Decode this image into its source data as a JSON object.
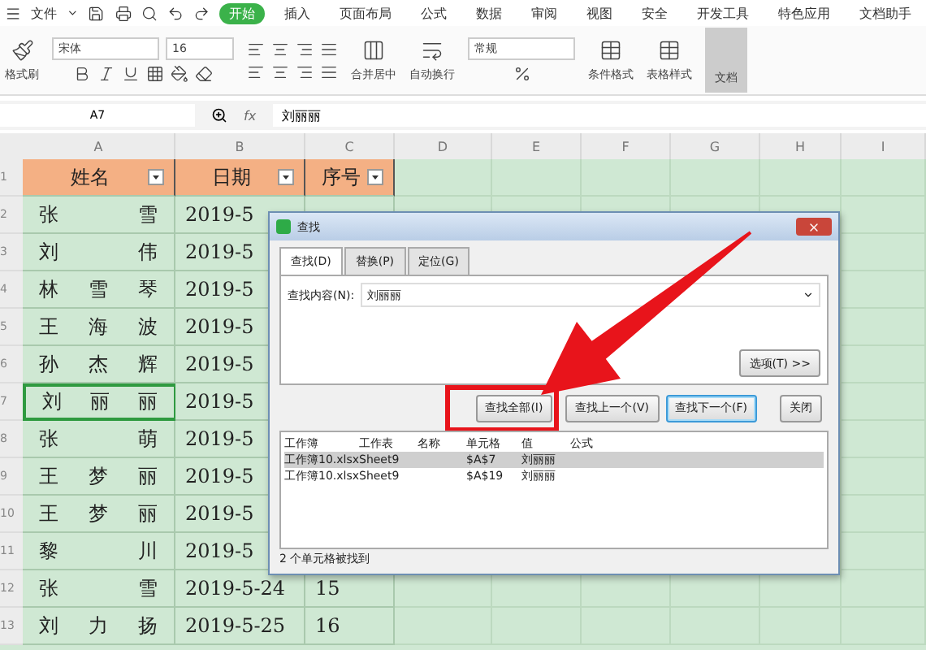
{
  "menu": {
    "label": "文件"
  },
  "ribbon_tabs": [
    {
      "label": "开始",
      "selected": true
    },
    {
      "label": "插入",
      "selected": false
    },
    {
      "label": "页面布局",
      "selected": false
    },
    {
      "label": "公式",
      "selected": false
    },
    {
      "label": "数据",
      "selected": false
    },
    {
      "label": "审阅",
      "selected": false
    },
    {
      "label": "视图",
      "selected": false
    },
    {
      "label": "安全",
      "selected": false
    },
    {
      "label": "开发工具",
      "selected": false
    },
    {
      "label": "特色应用",
      "selected": false
    },
    {
      "label": "文档助手",
      "selected": false
    }
  ],
  "toolbar": {
    "format_painter": "格式刷",
    "font": "宋体",
    "font_size": "16",
    "merge": "合并居中",
    "wrap": "自动换行",
    "number_format": "常规",
    "conditional": "条件格式",
    "table_style": "表格样式",
    "doc": "文档"
  },
  "formula_bar": {
    "cell": "A7",
    "fx_label": "fx",
    "value": "刘丽丽"
  },
  "columns": [
    "A",
    "B",
    "C",
    "D",
    "E",
    "F",
    "G",
    "H",
    "I"
  ],
  "header_row": {
    "number": "1",
    "cells": [
      "姓名",
      "日期",
      "序号"
    ]
  },
  "rows": [
    {
      "number": "2",
      "name": "张雪",
      "date": "2019-5",
      "seq": "",
      "selected": false
    },
    {
      "number": "3",
      "name": "刘伟",
      "date": "2019-5",
      "seq": "",
      "selected": false
    },
    {
      "number": "4",
      "name": "林雪琴",
      "date": "2019-5",
      "seq": "",
      "selected": false
    },
    {
      "number": "5",
      "name": "王海波",
      "date": "2019-5",
      "seq": "",
      "selected": false
    },
    {
      "number": "6",
      "name": "孙杰辉",
      "date": "2019-5",
      "seq": "",
      "selected": false
    },
    {
      "number": "7",
      "name": "刘丽丽",
      "date": "2019-5",
      "seq": "",
      "selected": true
    },
    {
      "number": "8",
      "name": "张萌",
      "date": "2019-5",
      "seq": "",
      "selected": false
    },
    {
      "number": "9",
      "name": "王梦丽",
      "date": "2019-5",
      "seq": "",
      "selected": false
    },
    {
      "number": "10",
      "name": "王梦丽",
      "date": "2019-5",
      "seq": "",
      "selected": false
    },
    {
      "number": "11",
      "name": "黎川",
      "date": "2019-5",
      "seq": "",
      "selected": false
    },
    {
      "number": "12",
      "name": "张雪",
      "date": "2019-5-24",
      "seq": "15",
      "selected": false
    },
    {
      "number": "13",
      "name": "刘力扬",
      "date": "2019-5-25",
      "seq": "16",
      "selected": false
    }
  ],
  "dialog": {
    "title": "查找",
    "tabs": [
      {
        "label": "查找(D)",
        "selected": true
      },
      {
        "label": "替换(P)",
        "selected": false
      },
      {
        "label": "定位(G)",
        "selected": false
      }
    ],
    "find_label": "查找内容(N):",
    "find_value": "刘丽丽",
    "options_button": "选项(T) >>",
    "buttons": [
      {
        "label": "查找全部(I)",
        "default": false,
        "highlighted": true
      },
      {
        "label": "查找上一个(V)",
        "default": false,
        "highlighted": false
      },
      {
        "label": "查找下一个(F)",
        "default": true,
        "highlighted": false
      },
      {
        "label": "关闭",
        "default": false,
        "highlighted": false
      }
    ],
    "result_columns": [
      "工作簿",
      "工作表",
      "名称",
      "单元格",
      "值",
      "公式"
    ],
    "results": [
      {
        "cells": [
          "工作簿10.xlsx",
          "Sheet9",
          "",
          "$A$7",
          "刘丽丽",
          ""
        ],
        "selected": true
      },
      {
        "cells": [
          "工作簿10.xlsx",
          "Sheet9",
          "",
          "$A$19",
          "刘丽丽",
          ""
        ],
        "selected": false
      }
    ],
    "status": "2 个单元格被找到"
  }
}
